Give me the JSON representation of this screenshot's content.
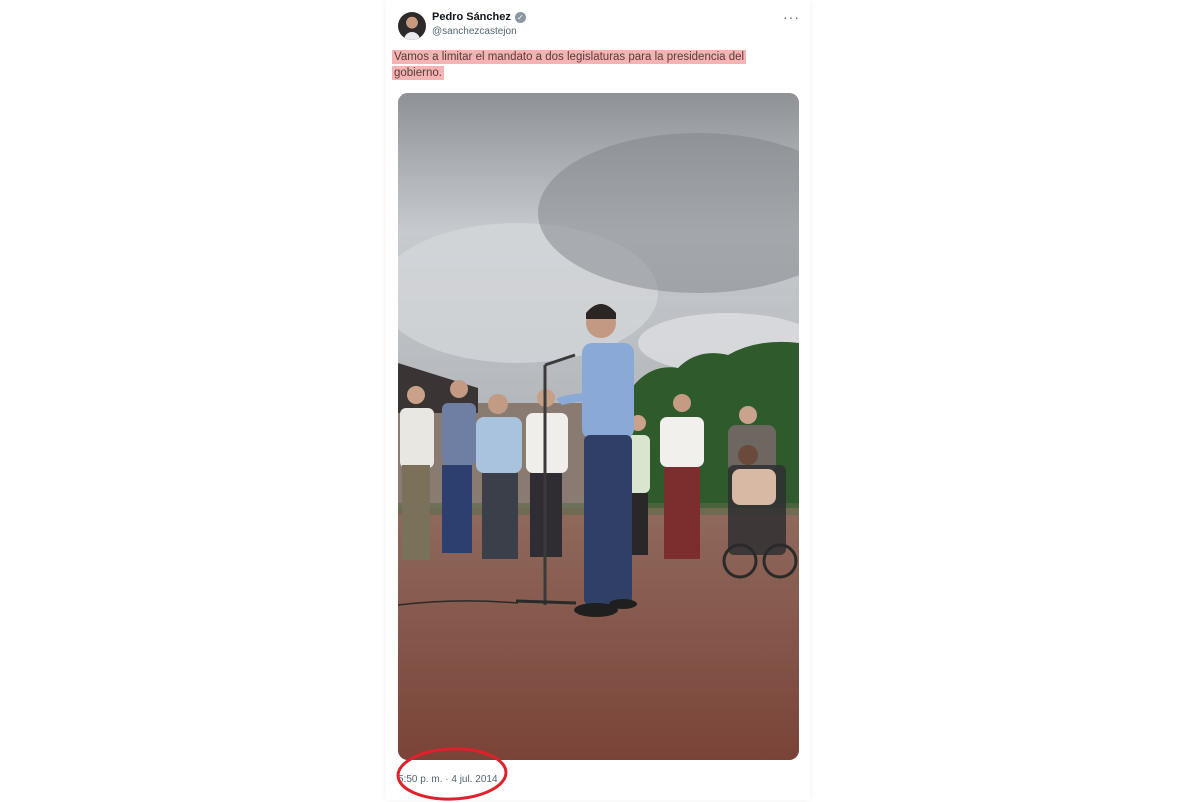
{
  "tweet": {
    "author_name": "Pedro Sánchez",
    "handle": "@sanchezcastejon",
    "text": "Vamos a limitar el mandato a dos legislaturas para la presidencia del gobierno.",
    "timestamp": "5:50 p. m. · 4 jul. 2014",
    "verified_icon": "✓",
    "more_icon": "···"
  },
  "colors": {
    "highlight": "#f5b3b3",
    "annotation_circle": "#e0202a",
    "sky": "#b8bcc2",
    "ground": "#8a5a4a",
    "trees": "#2f5a2c"
  },
  "icons": {
    "verified": "verified-badge-icon",
    "more": "more-options-icon"
  }
}
